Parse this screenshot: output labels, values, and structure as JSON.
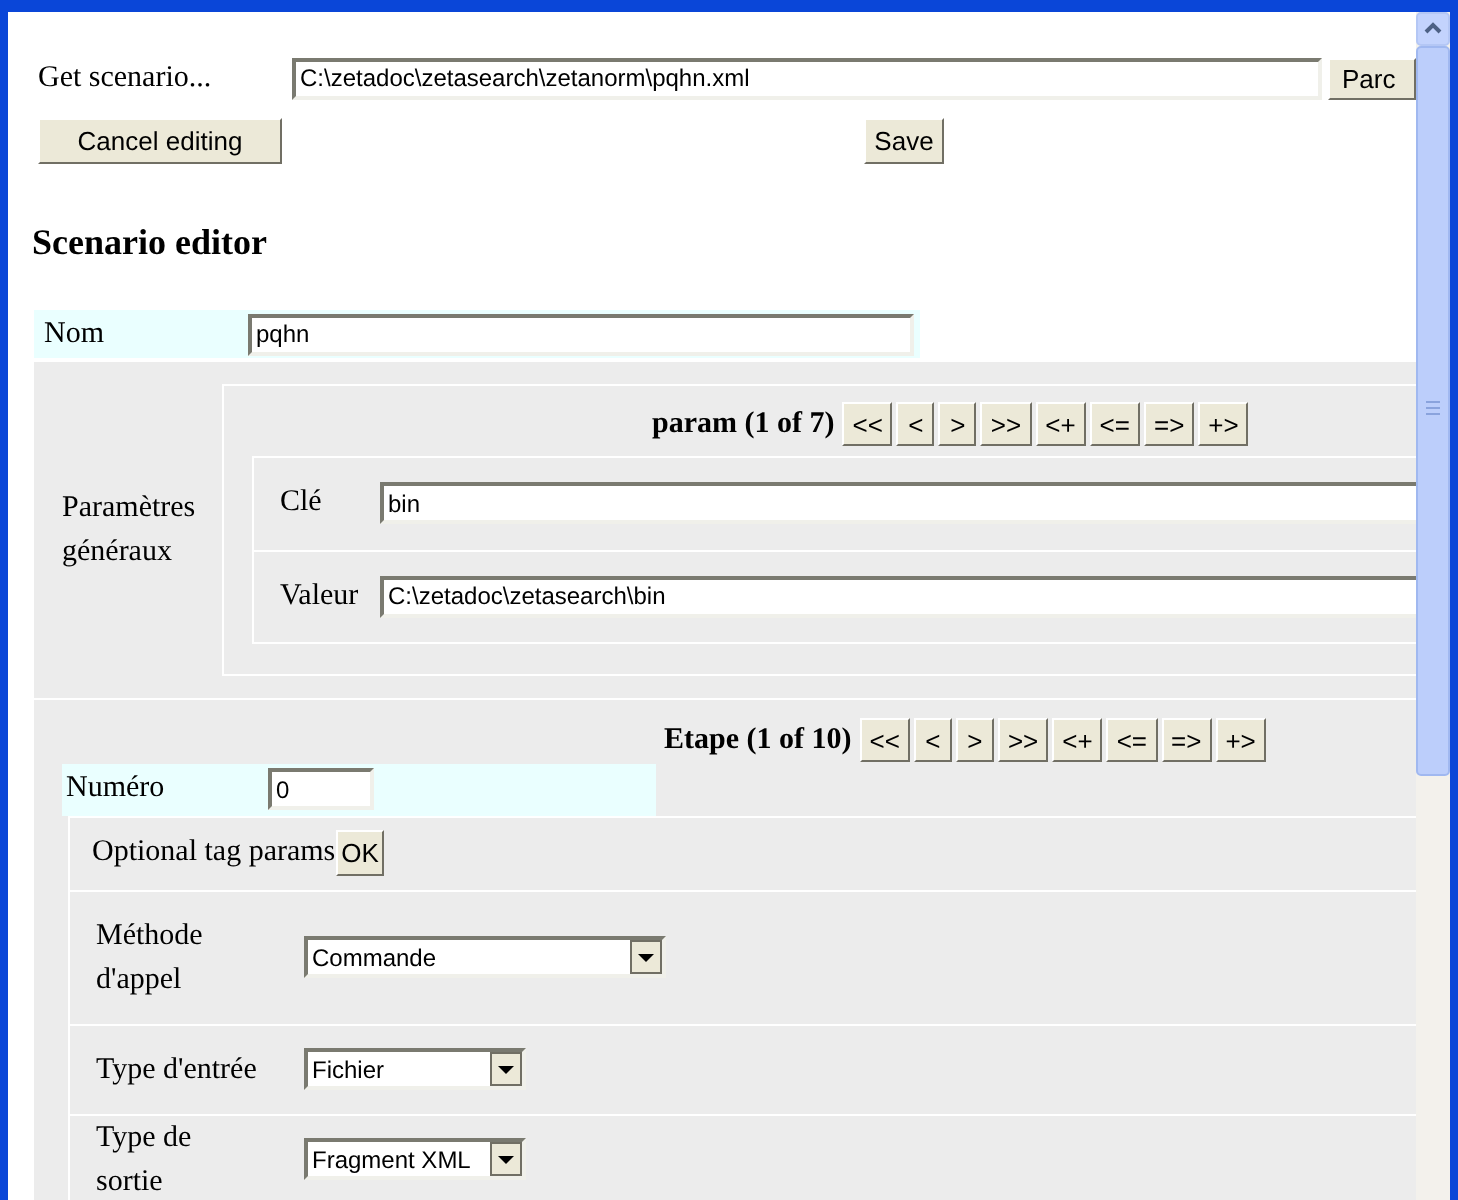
{
  "get_scenario": {
    "label": "Get scenario...",
    "path": "C:\\zetadoc\\zetasearch\\zetanorm\\pqhn.xml",
    "browse_button": "Parc"
  },
  "actions": {
    "cancel": "Cancel editing",
    "save": "Save"
  },
  "heading": "Scenario editor",
  "nom": {
    "label": "Nom",
    "value": "pqhn"
  },
  "params": {
    "label": "Paramètres généraux",
    "nav_title": "param (1 of 7)",
    "nav_buttons": [
      "<<",
      "<",
      ">",
      ">>",
      "<+",
      "<=",
      "=>",
      "+>"
    ],
    "fields": [
      {
        "label": "Clé",
        "value": "bin"
      },
      {
        "label": "Valeur",
        "value": "C:\\zetadoc\\zetasearch\\bin"
      }
    ]
  },
  "etape": {
    "nav_title": "Etape (1 of 10)",
    "nav_buttons": [
      "<<",
      "<",
      ">",
      ">>",
      "<+",
      "<=",
      "=>",
      "+>"
    ],
    "numero": {
      "label": "Numéro",
      "value": "0"
    },
    "optional": {
      "label": "Optional tag params",
      "button": "OK"
    },
    "selects": [
      {
        "label": "Méthode d'appel",
        "value": "Commande"
      },
      {
        "label": "Type d'entrée",
        "value": "Fichier"
      },
      {
        "label": "Type de sortie",
        "value": "Fragment XML"
      }
    ]
  }
}
